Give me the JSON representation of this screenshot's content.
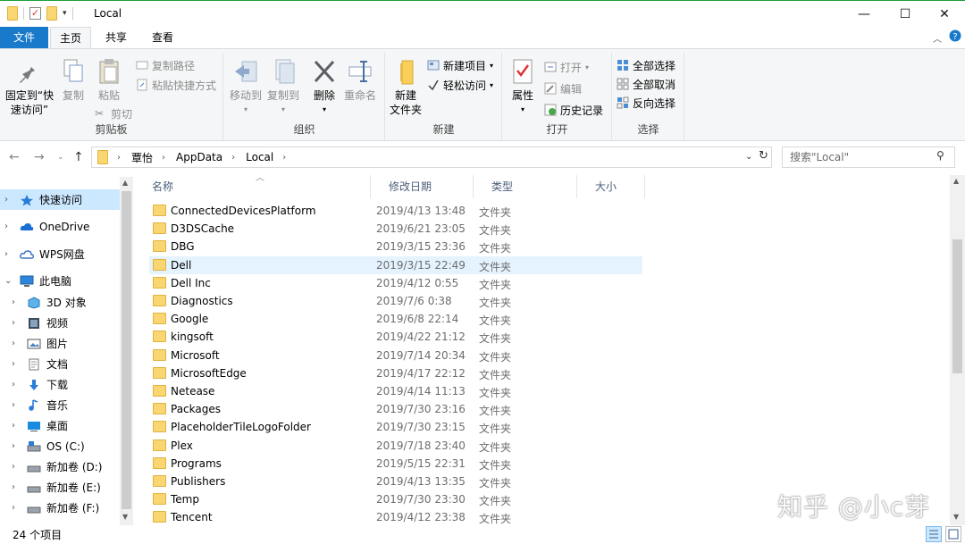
{
  "window": {
    "title": "Local",
    "minimize_glyph": "—",
    "maximize_glyph": "☐",
    "close_glyph": "✕"
  },
  "tabs": {
    "file": "文件",
    "home": "主页",
    "share": "共享",
    "view": "查看"
  },
  "ribbon": {
    "clipboard": {
      "label": "剪贴板",
      "pin": "固定到“快速访问”",
      "pin_line1": "固定到“快",
      "pin_line2": "速访问”",
      "copy": "复制",
      "paste": "粘贴",
      "copy_path": "复制路径",
      "paste_shortcut": "粘贴快捷方式",
      "cut": "剪切"
    },
    "organize": {
      "label": "组织",
      "move_to": "移动到",
      "copy_to": "复制到",
      "delete": "删除",
      "rename": "重命名"
    },
    "new": {
      "label": "新建",
      "new_folder_line1": "新建",
      "new_folder_line2": "文件夹",
      "new_item": "新建项目",
      "easy_access": "轻松访问"
    },
    "open": {
      "label": "打开",
      "properties": "属性",
      "open": "打开",
      "edit": "编辑",
      "history": "历史记录"
    },
    "select": {
      "label": "选择",
      "select_all": "全部选择",
      "select_none": "全部取消",
      "invert": "反向选择"
    }
  },
  "address": {
    "crumbs": [
      "覃怡",
      "AppData",
      "Local"
    ],
    "search_placeholder": "搜索\"Local\""
  },
  "nav": {
    "items": [
      {
        "label": "快速访问",
        "icon": "star-icon",
        "expand": "›"
      },
      {
        "label": "OneDrive",
        "icon": "cloud-icon",
        "expand": "›"
      },
      {
        "label": "WPS网盘",
        "icon": "wps-cloud-icon",
        "expand": "›"
      },
      {
        "label": "此电脑",
        "icon": "computer-icon",
        "expand": "⌄"
      },
      {
        "label": "3D 对象",
        "icon": "cube-icon",
        "expand": "›"
      },
      {
        "label": "视频",
        "icon": "video-icon",
        "expand": "›"
      },
      {
        "label": "图片",
        "icon": "picture-icon",
        "expand": "›"
      },
      {
        "label": "文档",
        "icon": "document-icon",
        "expand": "›"
      },
      {
        "label": "下载",
        "icon": "download-icon",
        "expand": "›"
      },
      {
        "label": "音乐",
        "icon": "music-icon",
        "expand": "›"
      },
      {
        "label": "桌面",
        "icon": "desktop-icon",
        "expand": "›"
      },
      {
        "label": "OS (C:)",
        "icon": "drive-os-icon",
        "expand": "›"
      },
      {
        "label": "新加卷 (D:)",
        "icon": "drive-icon",
        "expand": "›"
      },
      {
        "label": "新加卷 (E:)",
        "icon": "drive-icon",
        "expand": "›"
      },
      {
        "label": "新加卷 (F:)",
        "icon": "drive-icon",
        "expand": "›"
      }
    ]
  },
  "columns": {
    "name": "名称",
    "date": "修改日期",
    "type": "类型",
    "size": "大小"
  },
  "files": [
    {
      "name": "ConnectedDevicesPlatform",
      "date": "2019/4/13 13:48",
      "type": "文件夹"
    },
    {
      "name": "D3DSCache",
      "date": "2019/6/21 23:05",
      "type": "文件夹"
    },
    {
      "name": "DBG",
      "date": "2019/3/15 23:36",
      "type": "文件夹"
    },
    {
      "name": "Dell",
      "date": "2019/3/15 22:49",
      "type": "文件夹"
    },
    {
      "name": "Dell Inc",
      "date": "2019/4/12 0:55",
      "type": "文件夹"
    },
    {
      "name": "Diagnostics",
      "date": "2019/7/6 0:38",
      "type": "文件夹"
    },
    {
      "name": "Google",
      "date": "2019/6/8 22:14",
      "type": "文件夹"
    },
    {
      "name": "kingsoft",
      "date": "2019/4/22 21:12",
      "type": "文件夹"
    },
    {
      "name": "Microsoft",
      "date": "2019/7/14 20:34",
      "type": "文件夹"
    },
    {
      "name": "MicrosoftEdge",
      "date": "2019/4/17 22:12",
      "type": "文件夹"
    },
    {
      "name": "Netease",
      "date": "2019/4/14 11:13",
      "type": "文件夹"
    },
    {
      "name": "Packages",
      "date": "2019/7/30 23:16",
      "type": "文件夹"
    },
    {
      "name": "PlaceholderTileLogoFolder",
      "date": "2019/7/30 23:15",
      "type": "文件夹"
    },
    {
      "name": "Plex",
      "date": "2019/7/18 23:40",
      "type": "文件夹"
    },
    {
      "name": "Programs",
      "date": "2019/5/15 22:31",
      "type": "文件夹"
    },
    {
      "name": "Publishers",
      "date": "2019/4/13 13:35",
      "type": "文件夹"
    },
    {
      "name": "Temp",
      "date": "2019/7/30 23:30",
      "type": "文件夹"
    },
    {
      "name": "Tencent",
      "date": "2019/4/12 23:38",
      "type": "文件夹"
    }
  ],
  "selected_file": "Dell",
  "status": {
    "count": "24 个项目"
  },
  "watermark": "知乎 @小c芽",
  "colors": {
    "accent": "#1979ca",
    "selection": "#cce8ff",
    "folder": "#f9d671"
  }
}
